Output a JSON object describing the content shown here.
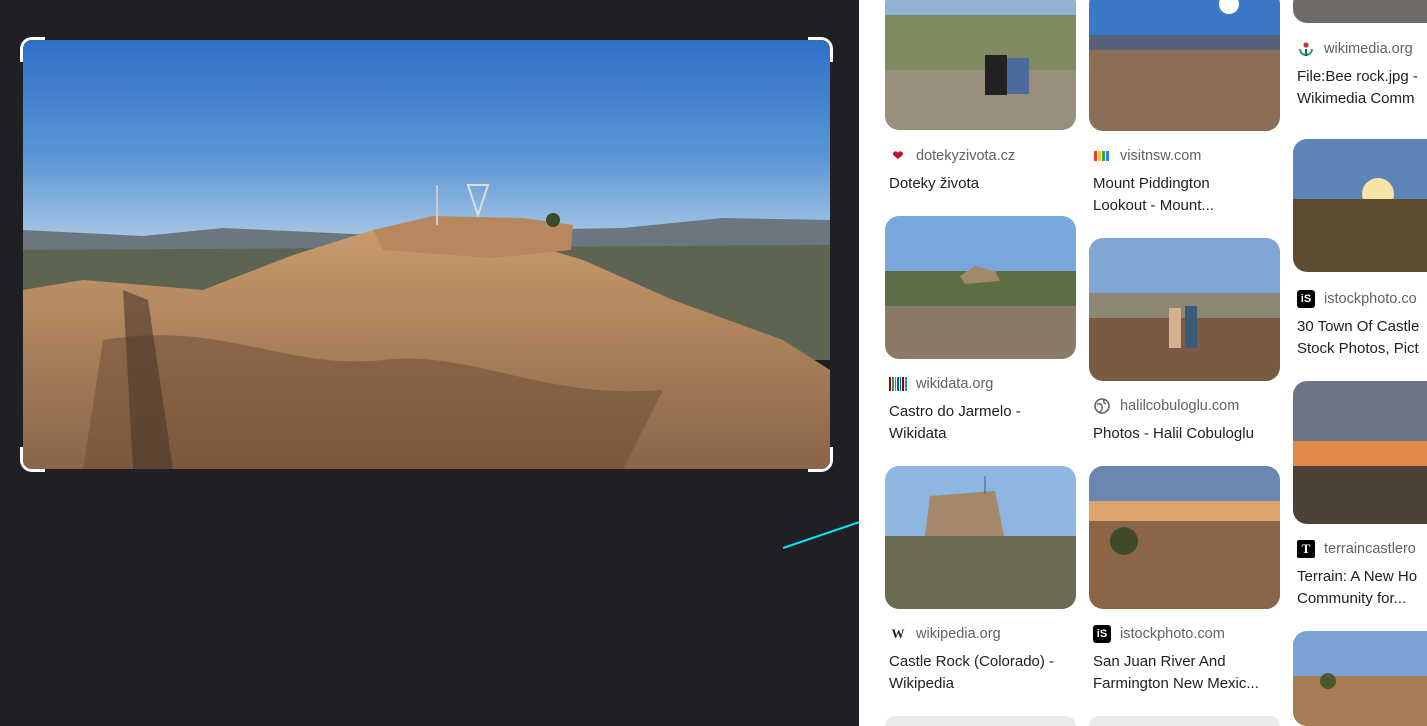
{
  "selection": {
    "image_description_label": "",
    "accent": "#ffffff"
  },
  "results": [
    {
      "col": 1,
      "source": "dotekyzivota.cz",
      "icon": "heart-logo-icon",
      "title1": "Doteky života",
      "title2": ""
    },
    {
      "col": 2,
      "source": "visitnsw.com",
      "icon": "nsw-logo-icon",
      "title1": "Mount Piddington",
      "title2": "Lookout - Mount..."
    },
    {
      "col": 3,
      "source": "wikimedia.org",
      "icon": "wikimedia-logo-icon",
      "title1": "File:Bee rock.jpg -",
      "title2": "Wikimedia Comm"
    },
    {
      "col": 1,
      "source": "wikidata.org",
      "icon": "wikidata-logo-icon",
      "title1": "Castro do Jarmelo -",
      "title2": "Wikidata"
    },
    {
      "col": 2,
      "source": "halilcobuloglu.com",
      "icon": "globe-icon",
      "title1": "Photos - Halil Cobuloglu",
      "title2": ""
    },
    {
      "col": 3,
      "source": "istockphoto.co",
      "icon": "istock-logo-icon",
      "title1": "30 Town Of Castle",
      "title2": "Stock Photos, Pict"
    },
    {
      "col": 1,
      "source": "wikipedia.org",
      "icon": "wikipedia-logo-icon",
      "title1": "Castle Rock (Colorado) -",
      "title2": "Wikipedia"
    },
    {
      "col": 2,
      "source": "istockphoto.com",
      "icon": "istock-logo-icon",
      "title1": "San Juan River And",
      "title2": "Farmington New Mexic..."
    },
    {
      "col": 3,
      "source": "terraincastlero",
      "icon": "terrain-logo-icon",
      "title1": "Terrain: A New Ho",
      "title2": "Community for..."
    }
  ],
  "icons": {
    "heart": "❤",
    "wikipedia": "W",
    "istock": "iS",
    "terrain": "T"
  },
  "colors": {
    "background_dark": "#1f2023",
    "arrow": "#00e5ee",
    "title_text": "#202124",
    "source_text": "#5f6368"
  }
}
